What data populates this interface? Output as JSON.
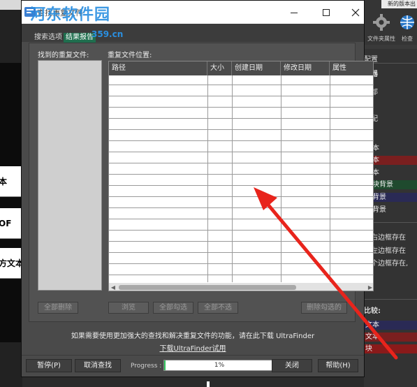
{
  "background": {
    "new_version": "新的版本出",
    "left_buttons": [
      "本",
      "OF",
      "方文本"
    ],
    "tools": [
      {
        "name": "gear-icon",
        "label": "文件夹属性"
      },
      {
        "name": "globe-icon",
        "label": "检查"
      }
    ],
    "right_labels": {
      "section1": "配置",
      "section2": "滤器",
      "items1": [
        "全部",
        "符",
        "匹配"
      ],
      "section3": "较:",
      "color_rows": [
        {
          "text": "文本",
          "color": "#333333"
        },
        {
          "text": "文本",
          "color": "#7a1f1f"
        },
        {
          "text": "文本",
          "color": "#333333"
        },
        {
          "text": "作块背景",
          "color": "#1f4a2e"
        },
        {
          "text": "块背景",
          "color": "#2a2a55"
        },
        {
          "text": "立背景",
          "color": "#333333"
        }
      ],
      "checks": [
        "于右边框存在",
        "于左边框存在",
        "两个边框存在,"
      ],
      "section4": "比较:",
      "bottom_rows": [
        {
          "text": "文本",
          "color": "#2a2a55"
        },
        {
          "text": "文本",
          "color": "#7a1f1f"
        },
        {
          "text": "块",
          "color": "#8a1a1a"
        }
      ]
    }
  },
  "dialog": {
    "title": "查找重复文件",
    "watermark": "河东软件园",
    "watermark_site": "359.cn",
    "tabs": [
      {
        "label": "搜索选项",
        "active": false
      },
      {
        "label": "结果报告",
        "active": true
      }
    ],
    "found_label": "找到的重复文件:",
    "location_label": "重复文件位置:",
    "columns": [
      "路径",
      "大小",
      "创建日期",
      "修改日期",
      "属性"
    ],
    "row_count": 18,
    "buttons_row": {
      "delete_all": "全部删除",
      "browse": "浏览",
      "check_all": "全部勾选",
      "uncheck_all": "全部不选",
      "delete_checked": "删除勾选的"
    },
    "info_text": "如果需要使用更加强大的查找和解决重复文件的功能，请在此下载 UltraFinder",
    "download_link": "下载UltraFinder试用",
    "bottom": {
      "pause": "暂停(P)",
      "cancel_search": "取消查找",
      "progress_label": "Progress :",
      "progress_value": 1,
      "progress_text": "1%",
      "close": "关闭",
      "help": "帮助(H)"
    }
  },
  "colors": {
    "accent_tab": "#1f6e4e",
    "progress_fill": "#2ec25a",
    "annotation": "#e8241c"
  }
}
